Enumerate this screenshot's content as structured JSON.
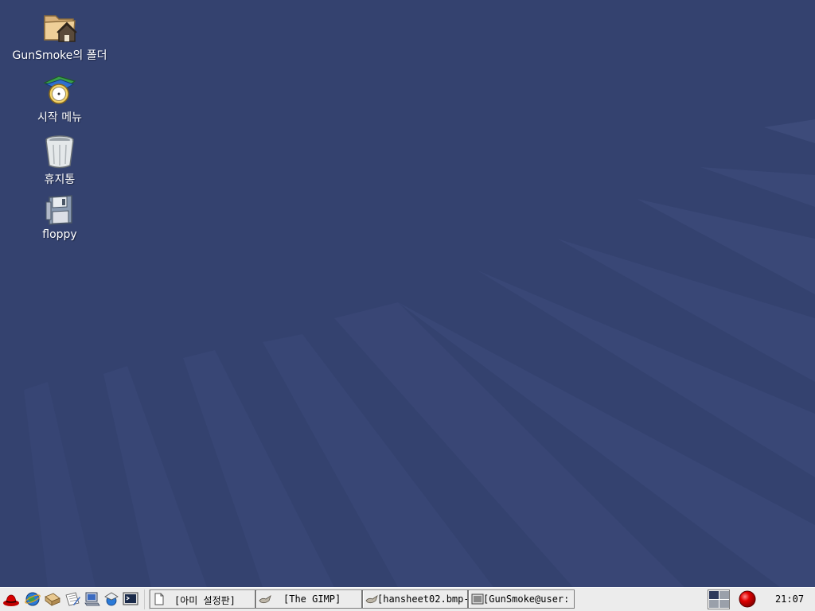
{
  "desktop": {
    "background_color": "#34426f",
    "icons": [
      {
        "label": "GunSmoke의 폴더",
        "icon": "home-folder-icon"
      },
      {
        "label": "시작 메뉴",
        "icon": "start-menu-icon"
      },
      {
        "label": "휴지통",
        "icon": "trash-icon"
      },
      {
        "label": "floppy",
        "icon": "floppy-icon"
      }
    ]
  },
  "taskbar": {
    "launchers": [
      {
        "icon": "redhat-menu-icon"
      },
      {
        "icon": "web-browser-icon"
      },
      {
        "icon": "mail-icon"
      },
      {
        "icon": "office-writer-icon"
      },
      {
        "icon": "file-manager-icon"
      },
      {
        "icon": "network-icon"
      },
      {
        "icon": "terminal-icon"
      }
    ],
    "tasks": [
      {
        "label": "[아미 설정판]",
        "icon": "document-icon"
      },
      {
        "label": "[The GIMP]",
        "icon": "gimp-icon"
      },
      {
        "label": "[hansheet02.bmp-",
        "icon": "gimp-image-icon"
      },
      {
        "label": "[GunSmoke@user:",
        "icon": "terminal-icon"
      }
    ],
    "clock": "21:07",
    "accent_colors": {
      "taskbar_bg": "#ececec",
      "record_button": "#d10000"
    }
  }
}
